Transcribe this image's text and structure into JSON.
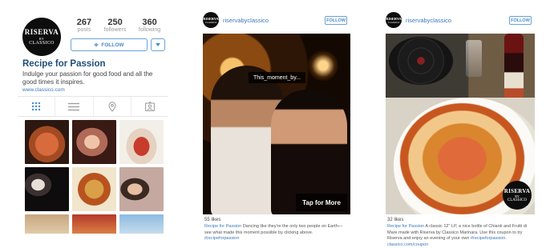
{
  "profile": {
    "logo": {
      "line1": "RISERVA",
      "line2": "BY",
      "line3": "CLASSICO"
    },
    "stats": [
      {
        "value": "267",
        "label": "posts"
      },
      {
        "value": "250",
        "label": "followers"
      },
      {
        "value": "360",
        "label": "following"
      }
    ],
    "follow_label": "FOLLOW",
    "follow_icon": "plus-icon",
    "dropdown_icon": "chevron-down-icon",
    "name": "Recipe for Passion",
    "bio": "Indulge your passion for good food and all the good times it inspires.",
    "link": "www.classico.com",
    "tabs": [
      "grid-icon",
      "list-icon",
      "location-icon",
      "tagged-icon"
    ]
  },
  "post1": {
    "username": "riservabyclassico",
    "follow_label": "FOLLOW",
    "moment_tag": "This_moment_by...",
    "tap_label": "Tap for More",
    "likes": "55 likes",
    "caption_lead": "Recipe for Passion",
    "caption_text": " Dancing like they're the only two people on Earth—see what made this moment possible by clicking above. ",
    "caption_tag": "#recipeforpassion",
    "more": "..."
  },
  "post2": {
    "username": "riservabyclassico",
    "follow_label": "FOLLOW",
    "likes": "32 likes",
    "caption_lead": "Recipe for Passion",
    "caption_text": " A classic 12\" LP, a nice bottle of Chianti and Frutti di Mare made with Riserva by Classico Marinara. Use this coupon to try Riserva and enjoy an evening of your own ",
    "caption_tag": "#recipeforpassion",
    "caption_sep": ". ",
    "caption_link": "classico.com/coupon",
    "more": "..."
  },
  "colors": {
    "accent": "#3b79b8",
    "name": "#1f4e79",
    "button_border": "#6aa3d6"
  }
}
